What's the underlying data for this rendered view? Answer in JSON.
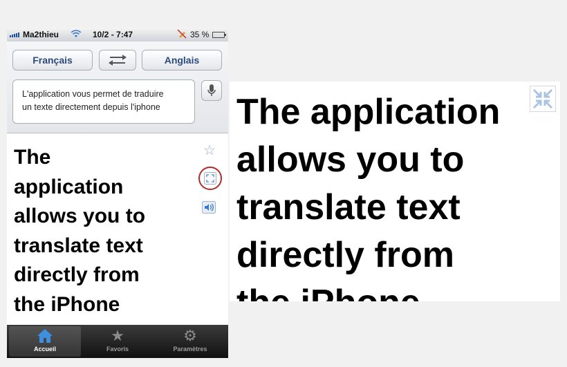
{
  "status_bar": {
    "carrier": "Ma2thieu",
    "time": "10/2 - 7:47",
    "battery": "35 %",
    "battery_level": 0.35
  },
  "translator": {
    "source_language": "Français",
    "target_language": "Anglais",
    "input_text_line1": "L'application vous permet de traduire",
    "input_text_line2": "un texte directement depuis l'iphone",
    "result_lines": [
      "The",
      "application",
      "allows you to",
      "translate text",
      "directly from",
      "the iPhone"
    ]
  },
  "tab_bar": {
    "tabs": [
      {
        "label": "Accueil",
        "icon": "home-icon",
        "active": true
      },
      {
        "label": "Favoris",
        "icon": "star-icon",
        "active": false
      },
      {
        "label": "Paramètres",
        "icon": "gear-icon",
        "active": false
      }
    ]
  },
  "fullscreen": {
    "lines": [
      "The application",
      "allows you to",
      "translate text",
      "directly from",
      "the iPhone"
    ]
  },
  "colors": {
    "accent": "#2c4a7c",
    "highlight_circle": "#b12a2a",
    "tab_bar": "#1c1c1c"
  }
}
